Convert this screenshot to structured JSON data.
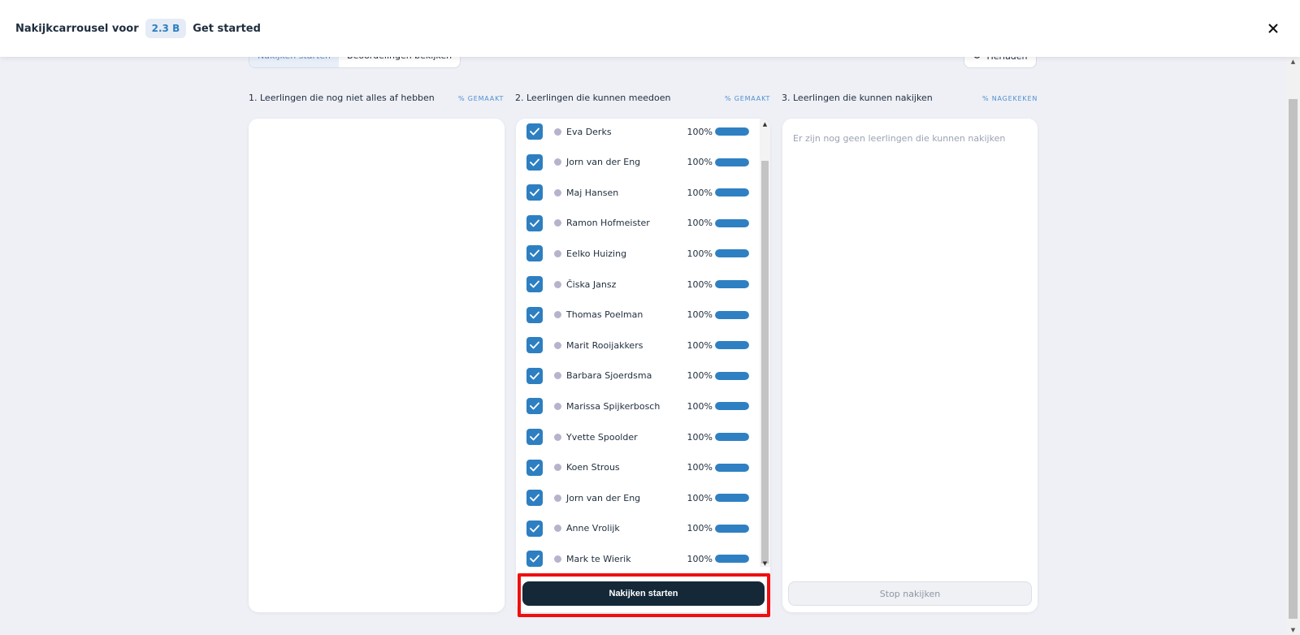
{
  "header": {
    "title": "Nakijkcarrousel voor",
    "badge": "2.3 B",
    "subtitle": "Get started",
    "close_icon": "close-icon"
  },
  "tabs": [
    {
      "label": "Nakijken starten",
      "active": true
    },
    {
      "label": "Beoordelingen bekijken",
      "active": false
    }
  ],
  "reload": {
    "label": "Herladen",
    "icon": "refresh-icon"
  },
  "columns": [
    {
      "title": "1. Leerlingen die nog niet alles af hebben",
      "sub": "% GEMAAKT"
    },
    {
      "title": "2. Leerlingen die kunnen meedoen",
      "sub": "% GEMAAKT"
    },
    {
      "title": "3. Leerlingen die kunnen nakijken",
      "sub": "% NAGEKEKEN"
    }
  ],
  "students": [
    {
      "name": "Eva Derks",
      "pct": "100%",
      "progress": 1.0,
      "checked": true
    },
    {
      "name": "Jorn van der Eng",
      "pct": "100%",
      "progress": 1.0,
      "checked": true
    },
    {
      "name": "Maj Hansen",
      "pct": "100%",
      "progress": 1.0,
      "checked": true
    },
    {
      "name": "Ramon Hofmeister",
      "pct": "100%",
      "progress": 1.0,
      "checked": true
    },
    {
      "name": "Eelko Huizing",
      "pct": "100%",
      "progress": 1.0,
      "checked": true
    },
    {
      "name": "Čiska Jansz",
      "pct": "100%",
      "progress": 1.0,
      "checked": true
    },
    {
      "name": "Thomas Poelman",
      "pct": "100%",
      "progress": 1.0,
      "checked": true
    },
    {
      "name": "Marit Rooijakkers",
      "pct": "100%",
      "progress": 1.0,
      "checked": true
    },
    {
      "name": "Barbara Sjoerdsma",
      "pct": "100%",
      "progress": 1.0,
      "checked": true
    },
    {
      "name": "Marissa Spijkerbosch",
      "pct": "100%",
      "progress": 1.0,
      "checked": true
    },
    {
      "name": "Yvette Spoolder",
      "pct": "100%",
      "progress": 1.0,
      "checked": true
    },
    {
      "name": "Koen Strous",
      "pct": "100%",
      "progress": 1.0,
      "checked": true
    },
    {
      "name": "Jorn van der Eng",
      "pct": "100%",
      "progress": 1.0,
      "checked": true
    },
    {
      "name": "Anne Vrolijk",
      "pct": "100%",
      "progress": 1.0,
      "checked": true
    },
    {
      "name": "Mark te Wierik",
      "pct": "100%",
      "progress": 1.0,
      "checked": true
    }
  ],
  "start_button": "Nakijken starten",
  "empty_message": "Er zijn nog geen leerlingen die kunnen nakijken",
  "stop_button": "Stop nakijken",
  "colors": {
    "accent": "#2d7fc1",
    "dark_button": "#142838",
    "highlight": "#ee0f10"
  }
}
